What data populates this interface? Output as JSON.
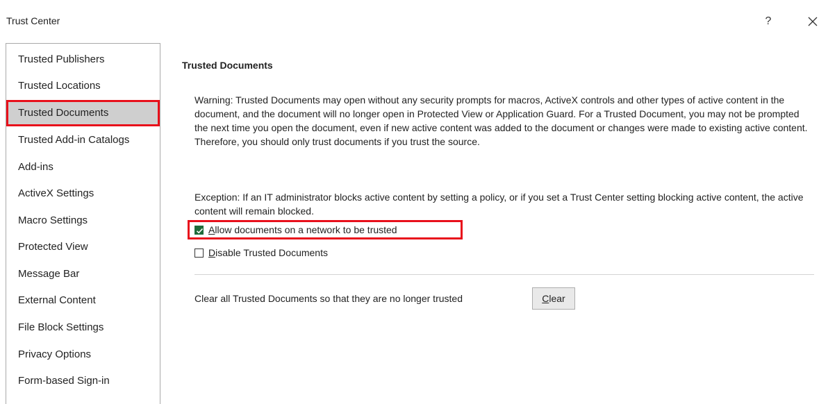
{
  "window": {
    "title": "Trust Center",
    "help_label": "?",
    "close_icon": "close-icon"
  },
  "sidebar": {
    "items": [
      {
        "label": "Trusted Publishers",
        "selected": false
      },
      {
        "label": "Trusted Locations",
        "selected": false
      },
      {
        "label": "Trusted Documents",
        "selected": true
      },
      {
        "label": "Trusted Add-in Catalogs",
        "selected": false
      },
      {
        "label": "Add-ins",
        "selected": false
      },
      {
        "label": "ActiveX Settings",
        "selected": false
      },
      {
        "label": "Macro Settings",
        "selected": false
      },
      {
        "label": "Protected View",
        "selected": false
      },
      {
        "label": "Message Bar",
        "selected": false
      },
      {
        "label": "External Content",
        "selected": false
      },
      {
        "label": "File Block Settings",
        "selected": false
      },
      {
        "label": "Privacy Options",
        "selected": false
      },
      {
        "label": "Form-based Sign-in",
        "selected": false
      }
    ]
  },
  "main": {
    "section_title": "Trusted Documents",
    "warning": "Warning: Trusted Documents may open without any security prompts for macros, ActiveX controls and other types of active content in the document, and the document will no longer open in Protected View or Application Guard. For a Trusted Document, you may not be prompted the next time you open the document, even if new active content was added to the document or changes were made to existing active content. Therefore, you should only trust documents if you trust the source.",
    "exception": "Exception: If an IT administrator blocks active content by setting a policy, or if you set a Trust Center setting blocking active content, the active content will remain blocked.",
    "options": [
      {
        "label_first": "A",
        "label_rest": "llow documents on a network to be trusted",
        "checked": true
      },
      {
        "label_first": "D",
        "label_rest": "isable Trusted Documents",
        "checked": false
      }
    ],
    "clear_text": "Clear all Trusted Documents so that they are no longer trusted",
    "clear_button": {
      "label_first": "C",
      "label_rest": "lear"
    }
  },
  "colors": {
    "highlight": "#e8101b",
    "checkbox_checked": "#1f6b3a",
    "selected_bg": "#cfcfcf"
  }
}
